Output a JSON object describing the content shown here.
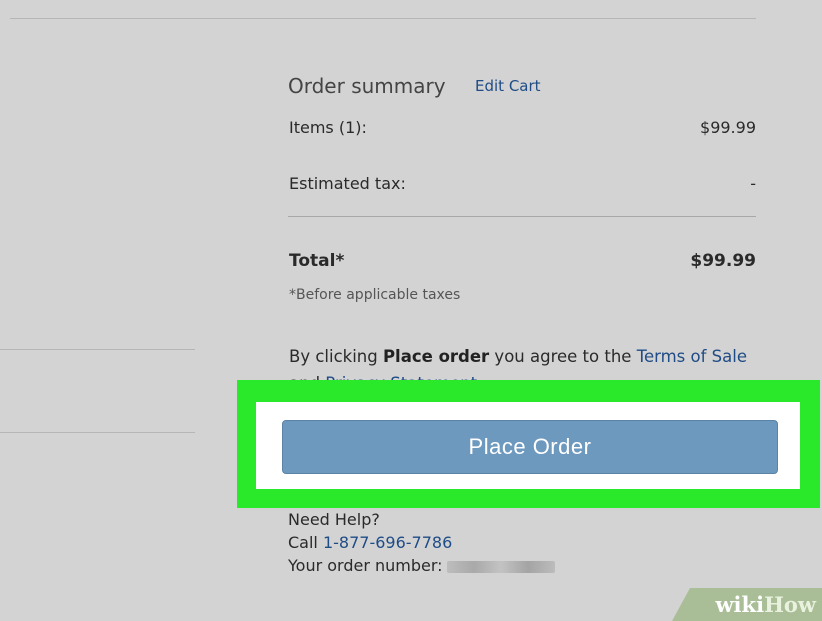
{
  "summary": {
    "title": "Order summary",
    "edit_cart": "Edit Cart",
    "items_label": "Items (1):",
    "items_value": "$99.99",
    "tax_label": "Estimated tax:",
    "tax_value": "-",
    "total_label": "Total*",
    "total_value": "$99.99",
    "note": "*Before applicable taxes"
  },
  "agreement": {
    "prefix": "By clicking ",
    "bold": "Place order",
    "middle": " you agree to the ",
    "terms": "Terms of Sale",
    "and": " and ",
    "privacy": "Privacy Statement",
    "suffix": "."
  },
  "place_order": {
    "label": "Place Order"
  },
  "help": {
    "title": "Need Help?",
    "call_prefix": "Call ",
    "phone": "1-877-696-7786",
    "order_number_label": "Your order number:"
  },
  "watermark": {
    "part1": "wiki",
    "part2": "How"
  },
  "colors": {
    "highlight": "#2ae82a",
    "button": "#6e99be",
    "link": "#1f4c86"
  }
}
